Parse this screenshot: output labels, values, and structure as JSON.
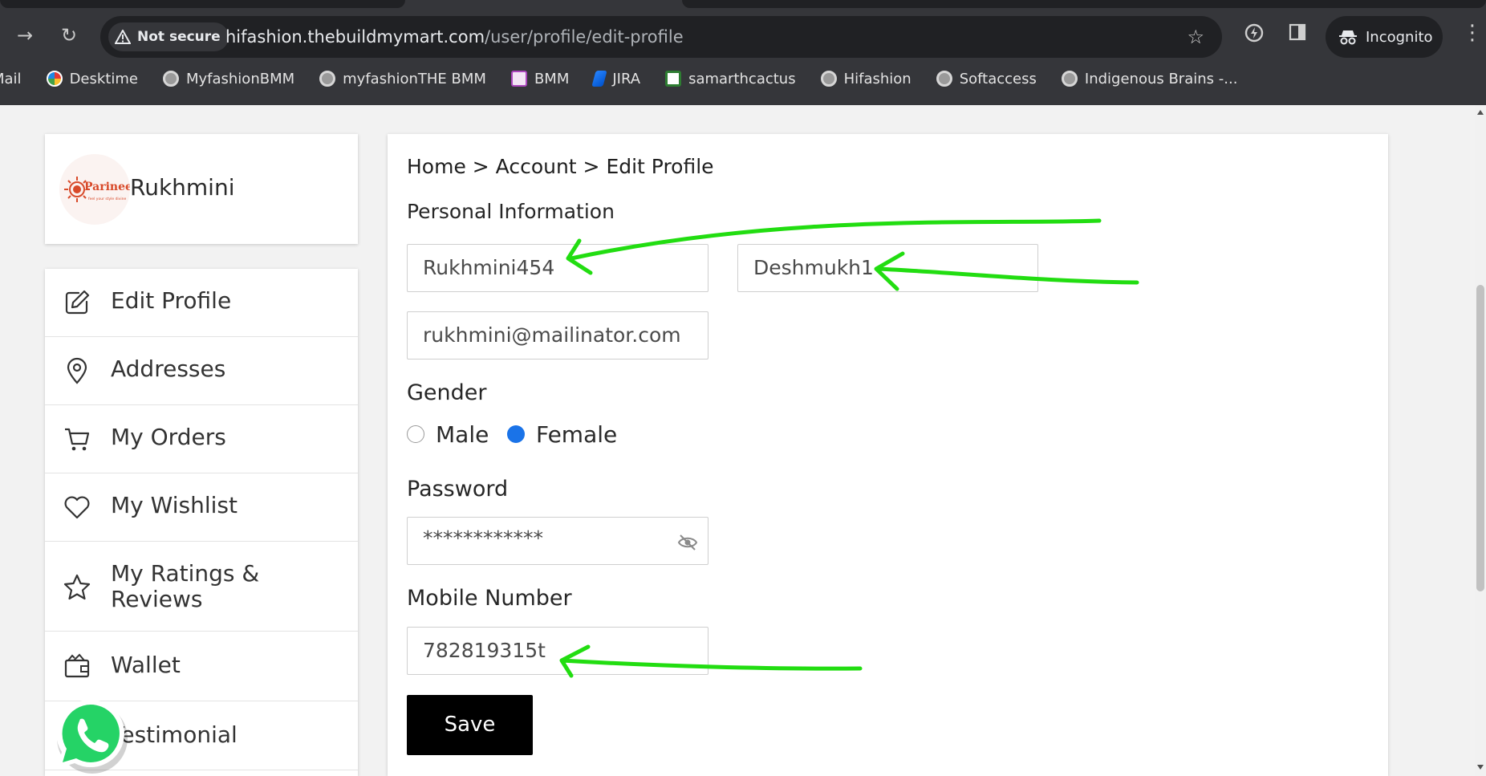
{
  "browser": {
    "security_label": "Not secure",
    "url_host": "hifashion.thebuildmymart.com",
    "url_path": "/user/profile/edit-profile",
    "incognito_label": "Incognito",
    "bookmarks": [
      {
        "label": "Mail",
        "icon": "mail-icon"
      },
      {
        "label": "Desktime",
        "icon": "desktime-icon"
      },
      {
        "label": "MyfashionBMM",
        "icon": "globe-icon"
      },
      {
        "label": "myfashionTHE BMM",
        "icon": "globe-icon"
      },
      {
        "label": "BMM",
        "icon": "bmm-icon"
      },
      {
        "label": "JIRA",
        "icon": "jira-icon"
      },
      {
        "label": "samarthcactus",
        "icon": "cactus-icon"
      },
      {
        "label": "Hifashion",
        "icon": "globe-icon"
      },
      {
        "label": "Softaccess",
        "icon": "globe-icon"
      },
      {
        "label": "Indigenous Brains -...",
        "icon": "globe-icon"
      }
    ]
  },
  "profile": {
    "name": "Rukhmini",
    "logo_text": "Parineeti",
    "logo_tagline": "feel your style divine"
  },
  "sidebar": {
    "items": [
      {
        "label": "Edit Profile",
        "icon": "edit-icon"
      },
      {
        "label": "Addresses",
        "icon": "location-pin-icon"
      },
      {
        "label": "My Orders",
        "icon": "cart-icon"
      },
      {
        "label": "My Wishlist",
        "icon": "heart-icon"
      },
      {
        "label": "My Ratings & Reviews",
        "icon": "star-icon"
      },
      {
        "label": "Wallet",
        "icon": "wallet-icon"
      },
      {
        "label": "Testimonial",
        "icon": "whatsapp-icon"
      }
    ]
  },
  "main": {
    "breadcrumb": "Home > Account > Edit Profile",
    "section_title": "Personal Information",
    "first_name": "Rukhmini454",
    "last_name": "Deshmukh1",
    "email": "rukhmini@mailinator.com",
    "gender_label": "Gender",
    "gender_options": [
      "Male",
      "Female"
    ],
    "gender_selected": "Female",
    "password_label": "Password",
    "password_value": "************",
    "mobile_label": "Mobile Number",
    "mobile_value": "782819315t",
    "save_label": "Save"
  },
  "colors": {
    "annotation": "#22dd11",
    "radio_selected": "#1a73e8",
    "chrome_dark": "#35363a"
  }
}
